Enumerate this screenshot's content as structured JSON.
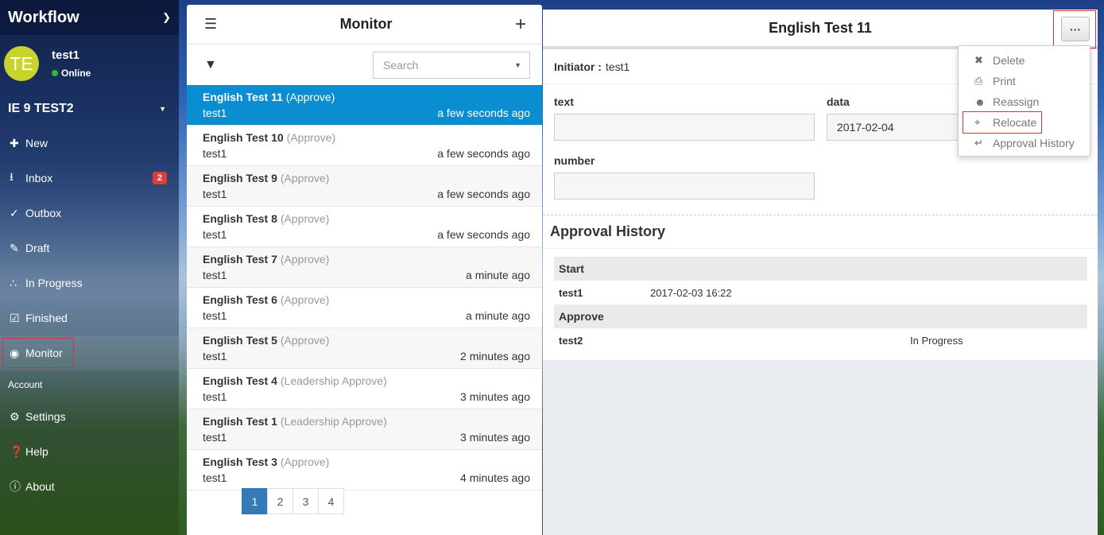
{
  "sidebar": {
    "brand": "Workflow",
    "user": {
      "initials": "TE",
      "name": "test1",
      "status": "Online"
    },
    "org": "IE 9 TEST2",
    "nav": [
      {
        "label": "New",
        "icon": "plus-icon"
      },
      {
        "label": "Inbox",
        "icon": "inbox-icon",
        "badge": "2"
      },
      {
        "label": "Outbox",
        "icon": "double-check-icon"
      },
      {
        "label": "Draft",
        "icon": "edit-icon"
      },
      {
        "label": "In Progress",
        "icon": "spinner-icon"
      },
      {
        "label": "Finished",
        "icon": "checkbox-icon"
      },
      {
        "label": "Monitor",
        "icon": "eye-icon"
      }
    ],
    "account_label": "Account",
    "account_nav": [
      {
        "label": "Settings",
        "icon": "gear-icon"
      },
      {
        "label": "Help",
        "icon": "help-icon"
      },
      {
        "label": "About",
        "icon": "info-icon"
      }
    ]
  },
  "list": {
    "title": "Monitor",
    "search_placeholder": "Search",
    "items": [
      {
        "name": "English Test 11",
        "step": "(Approve)",
        "user": "test1",
        "time": "a few seconds ago"
      },
      {
        "name": "English Test 10",
        "step": "(Approve)",
        "user": "test1",
        "time": "a few seconds ago"
      },
      {
        "name": "English Test 9",
        "step": "(Approve)",
        "user": "test1",
        "time": "a few seconds ago"
      },
      {
        "name": "English Test 8",
        "step": "(Approve)",
        "user": "test1",
        "time": "a few seconds ago"
      },
      {
        "name": "English Test 7",
        "step": "(Approve)",
        "user": "test1",
        "time": "a minute ago"
      },
      {
        "name": "English Test 6",
        "step": "(Approve)",
        "user": "test1",
        "time": "a minute ago"
      },
      {
        "name": "English Test 5",
        "step": "(Approve)",
        "user": "test1",
        "time": "2 minutes ago"
      },
      {
        "name": "English Test 4",
        "step": "(Leadership Approve)",
        "user": "test1",
        "time": "3 minutes ago"
      },
      {
        "name": "English Test 1",
        "step": "(Leadership Approve)",
        "user": "test1",
        "time": "3 minutes ago"
      },
      {
        "name": "English Test 3",
        "step": "(Approve)",
        "user": "test1",
        "time": "4 minutes ago"
      }
    ],
    "pages": [
      "1",
      "2",
      "3",
      "4"
    ]
  },
  "detail": {
    "title": "English Test 11",
    "more_label": "···",
    "initiator_label": "Initiator :",
    "initiator_value": "test1",
    "fields": {
      "text_label": "text",
      "text_value": "",
      "data_label": "data",
      "data_value": "2017-02-04",
      "number_label": "number",
      "number_value": ""
    },
    "history_title": "Approval History",
    "history": {
      "start_label": "Start",
      "start_user": "test1",
      "start_time": "2017-02-03 16:22",
      "approve_label": "Approve",
      "approve_user": "test2",
      "approve_status": "In Progress"
    }
  },
  "menu": {
    "items": [
      {
        "label": "Delete",
        "icon": "times-circle-icon"
      },
      {
        "label": "Print",
        "icon": "printer-icon"
      },
      {
        "label": "Reassign",
        "icon": "user-icon"
      },
      {
        "label": "Relocate",
        "icon": "compress-icon"
      },
      {
        "label": "Approval History",
        "icon": "history-icon"
      }
    ]
  }
}
